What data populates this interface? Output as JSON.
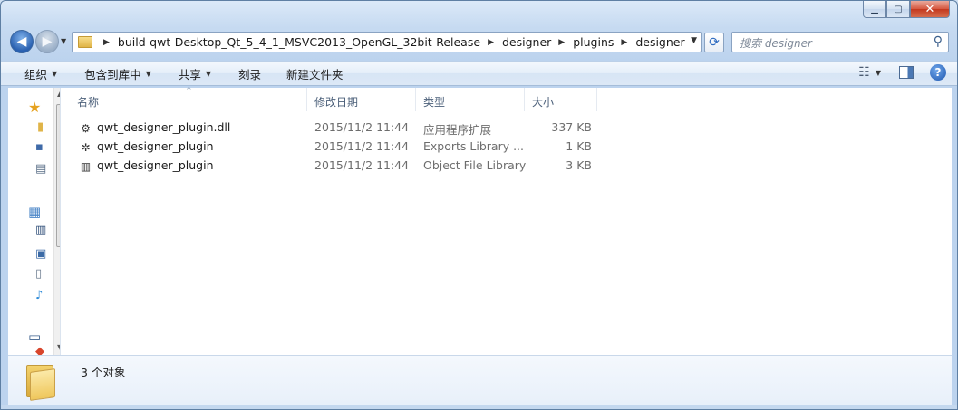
{
  "window": {
    "caption_buttons": [
      "minimize",
      "maximize",
      "close"
    ]
  },
  "navigation": {
    "breadcrumbs": [
      "build-qwt-Desktop_Qt_5_4_1_MSVC2013_OpenGL_32bit-Release",
      "designer",
      "plugins",
      "designer"
    ],
    "search_placeholder": "搜索 designer"
  },
  "toolbar": {
    "organize": "组织",
    "include_in_library": "包含到库中",
    "share": "共享",
    "burn": "刻录",
    "new_folder": "新建文件夹"
  },
  "columns": {
    "name": "名称",
    "date": "修改日期",
    "type": "类型",
    "size": "大小"
  },
  "files": [
    {
      "icon": "dll-file-icon",
      "name": "qwt_designer_plugin.dll",
      "date": "2015/11/2 11:44",
      "type": "应用程序扩展",
      "size": "337 KB"
    },
    {
      "icon": "exports-library-icon",
      "name": "qwt_designer_plugin",
      "date": "2015/11/2 11:44",
      "type": "Exports Library ...",
      "size": "1 KB"
    },
    {
      "icon": "object-library-icon",
      "name": "qwt_designer_plugin",
      "date": "2015/11/2 11:44",
      "type": "Object File Library",
      "size": "3 KB"
    }
  ],
  "details": {
    "item_count": "3 个对象"
  }
}
